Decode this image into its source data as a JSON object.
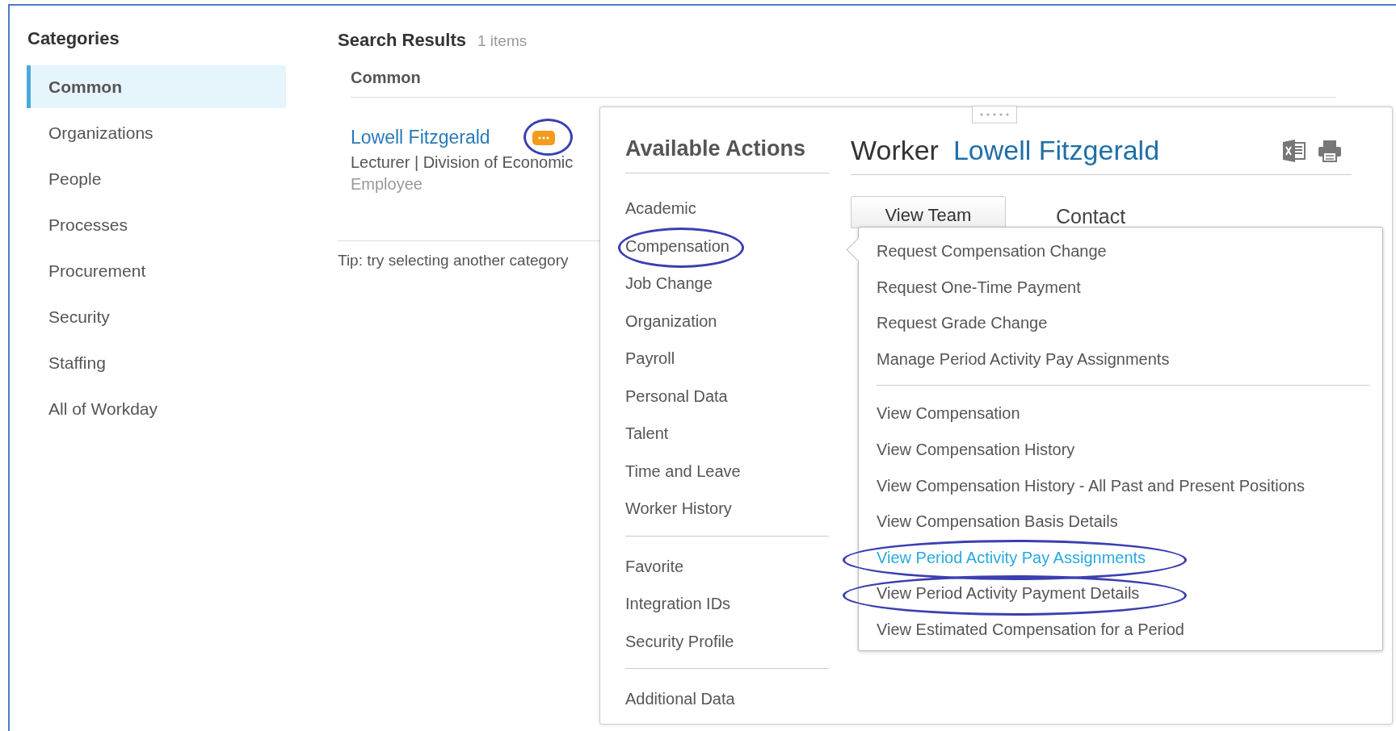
{
  "sidebar": {
    "title": "Categories",
    "items": [
      {
        "label": "Common",
        "selected": true
      },
      {
        "label": "Organizations",
        "selected": false
      },
      {
        "label": "People",
        "selected": false
      },
      {
        "label": "Processes",
        "selected": false
      },
      {
        "label": "Procurement",
        "selected": false
      },
      {
        "label": "Security",
        "selected": false
      },
      {
        "label": "Staffing",
        "selected": false
      },
      {
        "label": "All of Workday",
        "selected": false
      }
    ]
  },
  "results": {
    "title": "Search Results",
    "count": "1 items",
    "group": "Common",
    "name": "Lowell Fitzgerald",
    "circled": true,
    "subtitle": "Lecturer | Division of Economic",
    "type": "Employee",
    "tip": "Tip: try selecting another category"
  },
  "popup": {
    "actions_title": "Available Actions",
    "groups": [
      {
        "items": [
          {
            "label": "Academic",
            "circled": false
          },
          {
            "label": "Compensation",
            "circled": true
          },
          {
            "label": "Job Change",
            "circled": false
          },
          {
            "label": "Organization",
            "circled": false
          },
          {
            "label": "Payroll",
            "circled": false
          },
          {
            "label": "Personal Data",
            "circled": false
          },
          {
            "label": "Talent",
            "circled": false
          },
          {
            "label": "Time and Leave",
            "circled": false
          },
          {
            "label": "Worker History",
            "circled": false
          }
        ]
      },
      {
        "items": [
          {
            "label": "Favorite",
            "circled": false
          },
          {
            "label": "Integration IDs",
            "circled": false
          },
          {
            "label": "Security Profile",
            "circled": false
          }
        ]
      },
      {
        "items": [
          {
            "label": "Additional Data",
            "circled": false
          }
        ]
      }
    ],
    "worker_label": "Worker",
    "worker_name": "Lowell Fitzgerald",
    "tab": "View Team",
    "contact": "Contact",
    "flyout": {
      "sections": [
        {
          "items": [
            {
              "label": "Request Compensation Change",
              "highlighted": false,
              "circled": false
            },
            {
              "label": "Request One-Time Payment",
              "highlighted": false,
              "circled": false
            },
            {
              "label": "Request Grade Change",
              "highlighted": false,
              "circled": false
            },
            {
              "label": "Manage Period Activity Pay Assignments",
              "highlighted": false,
              "circled": false
            }
          ]
        },
        {
          "items": [
            {
              "label": "View Compensation",
              "highlighted": false,
              "circled": false
            },
            {
              "label": "View Compensation History",
              "highlighted": false,
              "circled": false
            },
            {
              "label": "View Compensation History - All Past and Present Positions",
              "highlighted": false,
              "circled": false
            },
            {
              "label": "View Compensation Basis Details",
              "highlighted": false,
              "circled": false
            },
            {
              "label": "View Period Activity Pay Assignments",
              "highlighted": true,
              "circled": true
            },
            {
              "label": "View Period Activity Payment Details",
              "highlighted": false,
              "circled": true
            },
            {
              "label": "View Estimated Compensation for a Period",
              "highlighted": false,
              "circled": false
            }
          ]
        }
      ]
    }
  }
}
